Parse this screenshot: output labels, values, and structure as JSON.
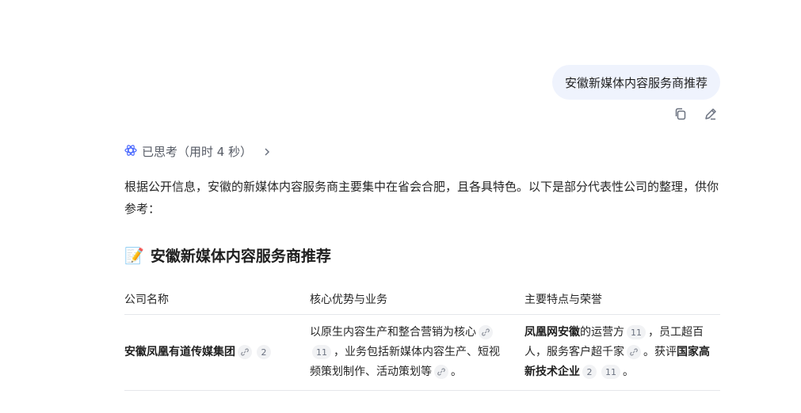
{
  "user_message": "安徽新媒体内容服务商推荐",
  "thinking_label": "已思考（用时 4 秒）",
  "intro": "根据公开信息，安徽的新媒体内容服务商主要集中在省会合肥，且各具特色。以下是部分代表性公司的整理，供你参考：",
  "section": {
    "emoji": "📝",
    "title": "安徽新媒体内容服务商推荐"
  },
  "table": {
    "headers": [
      "公司名称",
      "核心优势与业务",
      "主要特点与荣誉"
    ],
    "row1": {
      "name": "安徽凤凰有道传媒集团",
      "name_cite": "2",
      "c2_a": "以原生内容生产和整合营销为核心",
      "c2_cite": "11",
      "c2_b": "，业务包括新媒体内容生产、短视频策划制作、活动策划等",
      "c2_c": "。",
      "c3_bold1": "凤凰网安徽",
      "c3_a": "的运营方",
      "c3_cite1": "11",
      "c3_b": "，员工超百人，服务客户超千家",
      "c3_c": "。获评",
      "c3_bold2": "国家高新技术企业",
      "c3_cite2": "2",
      "c3_cite3": "11",
      "c3_d": "。"
    }
  },
  "icons": [
    "copy-icon",
    "edit-icon",
    "atom-icon",
    "chevron-right-icon",
    "link-icon",
    "memo-icon"
  ]
}
